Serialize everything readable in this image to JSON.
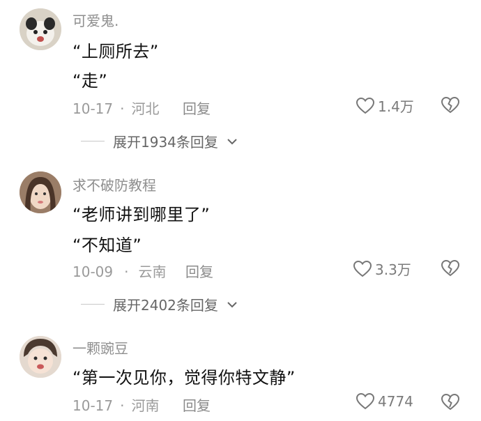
{
  "comments": [
    {
      "username": "可爱鬼.",
      "lines": [
        "“上厕所去”",
        "“走”"
      ],
      "date": "10-17",
      "location": "河北",
      "reply_label": "回复",
      "likes": "1.4万",
      "expand_label": "展开1934条回复"
    },
    {
      "username": "求不破防教程",
      "lines": [
        "“老师讲到哪里了”",
        "“不知道”"
      ],
      "date": "10-09",
      "location": "云南",
      "reply_label": "回复",
      "likes": "3.3万",
      "expand_label": "展开2402条回复"
    },
    {
      "username": "一颗豌豆",
      "lines": [
        "“第一次见你，觉得你特文静”"
      ],
      "date": "10-17",
      "location": "河南",
      "reply_label": "回复",
      "likes": "4774"
    }
  ],
  "icons": {
    "like": "heart-outline-icon",
    "dislike": "broken-heart-icon",
    "expand": "chevron-down-icon"
  },
  "colors": {
    "username": "#8e8e8e",
    "meta": "#9a9a9a",
    "text": "#111111"
  }
}
